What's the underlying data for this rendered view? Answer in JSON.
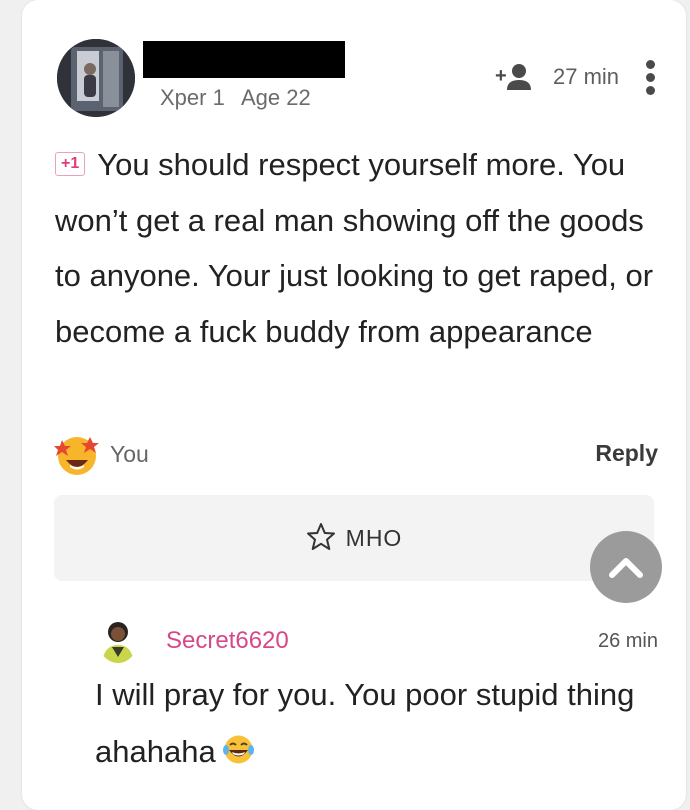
{
  "comment": {
    "author": {
      "name_redacted": true,
      "xper_level": "Xper 1",
      "age": "Age 22"
    },
    "time": "27 min",
    "badge": "+1",
    "text": "You should respect yourself more. You won’t get a real man showing off the goods to anyone. Your just looking to get raped, or become a fuck buddy from appearance",
    "reaction": {
      "icon": "star-struck-emoji-icon",
      "by": "You"
    },
    "reply_label": "Reply",
    "mho_label": "MHO"
  },
  "reply": {
    "username": "Secret6620",
    "time": "26 min",
    "text": "I will pray for you. You poor stupid thing ahahaha",
    "emoji": "tears-of-joy-emoji-icon"
  },
  "colors": {
    "username_pink": "#d54889",
    "badge_pink": "#e33b7a",
    "scroll_button_gray": "#9b9b9b"
  }
}
